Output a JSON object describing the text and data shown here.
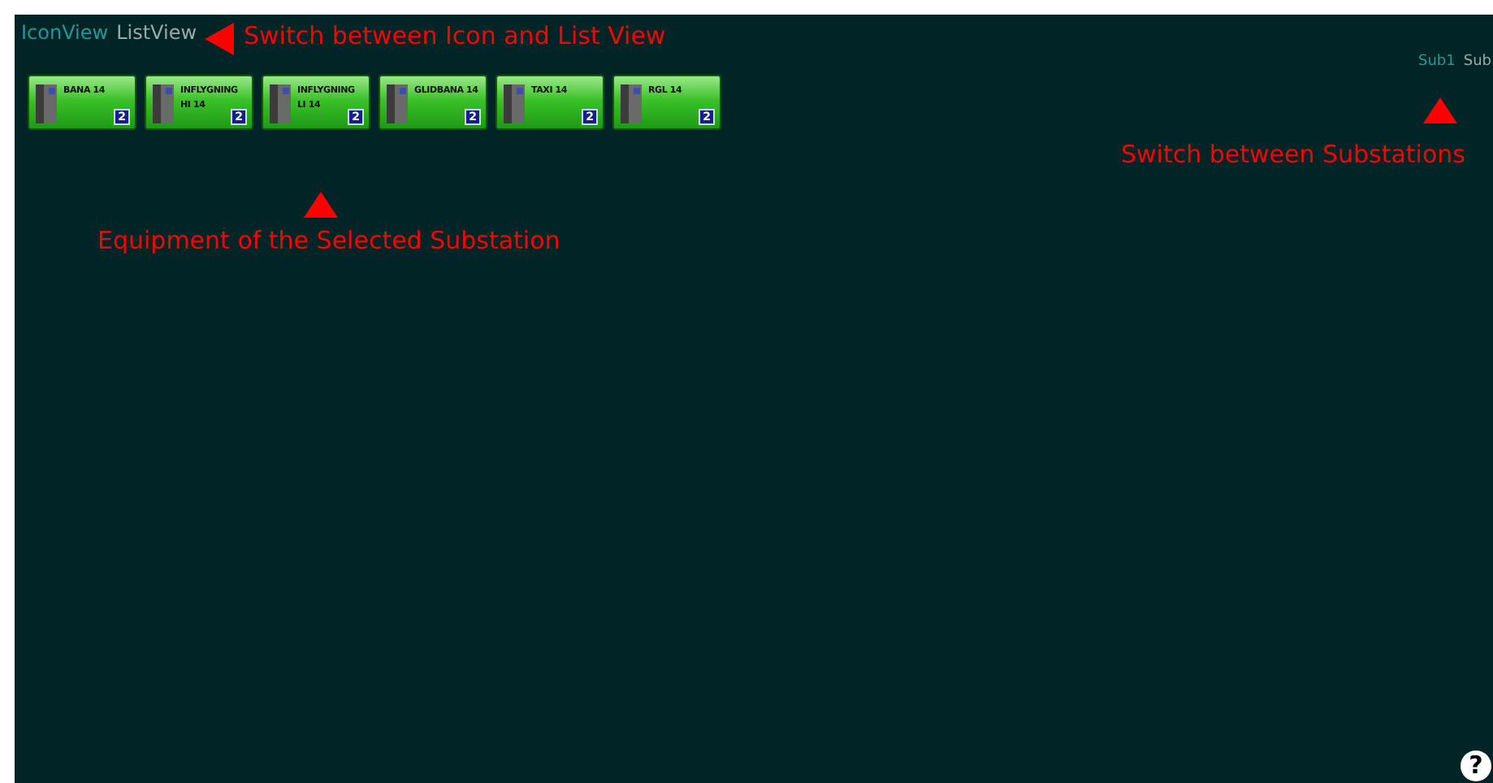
{
  "view_tabs": [
    {
      "label": "IconView",
      "selected": true
    },
    {
      "label": "ListView",
      "selected": false
    }
  ],
  "substation_tabs": [
    {
      "label": "Sub1",
      "selected": true
    },
    {
      "label": "Sub",
      "selected": false
    }
  ],
  "equipment": [
    {
      "name": "BANA 14",
      "badge": "2"
    },
    {
      "name": "INFLYGNING HI 14",
      "badge": "2"
    },
    {
      "name": "INFLYGNING LI 14",
      "badge": "2"
    },
    {
      "name": "GLIDBANA 14",
      "badge": "2"
    },
    {
      "name": "TAXI 14",
      "badge": "2"
    },
    {
      "name": "RGL 14",
      "badge": "2"
    }
  ],
  "annotations": [
    {
      "text": "Switch between Icon and List View"
    },
    {
      "text": "Switch between Substations"
    },
    {
      "text": "Equipment of the Selected Substation"
    }
  ],
  "help": "?"
}
